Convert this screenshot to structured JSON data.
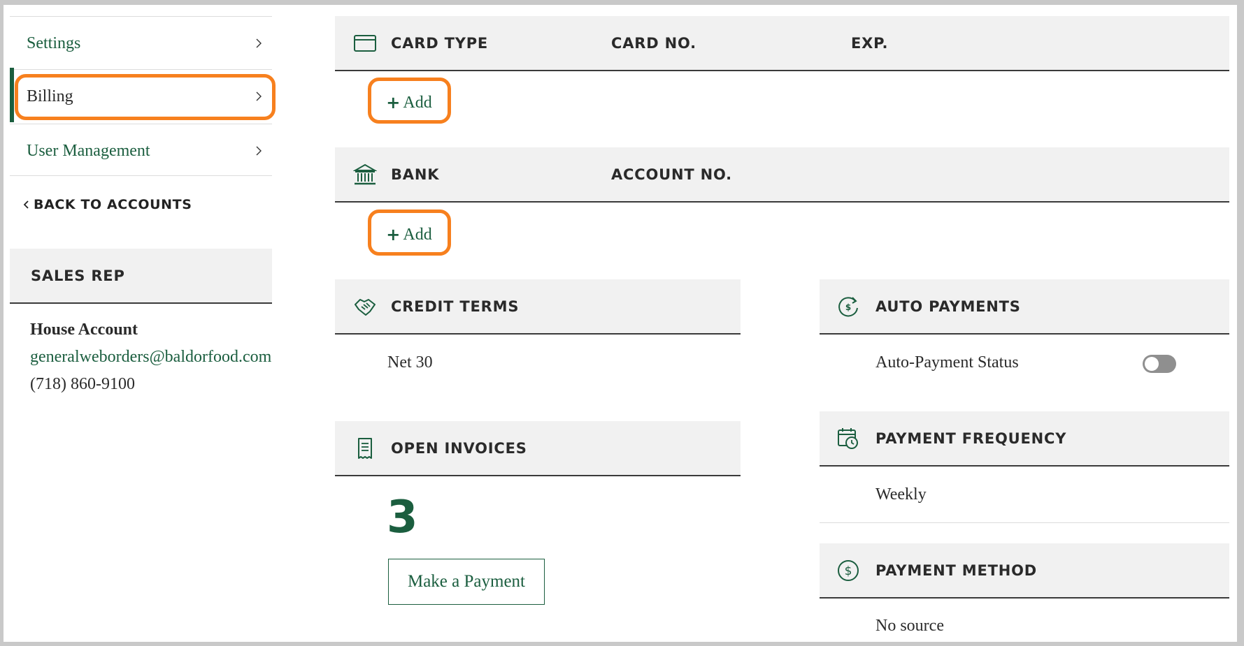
{
  "sidebar": {
    "items": [
      {
        "label": "Settings",
        "icon": "chevron-right-icon"
      },
      {
        "label": "Billing",
        "icon": "chevron-right-icon",
        "active": true
      },
      {
        "label": "User Management",
        "icon": "chevron-right-icon"
      }
    ],
    "back_link": "BACK TO ACCOUNTS",
    "sales_rep": {
      "heading": "SALES REP",
      "name": "House Account",
      "email": "generalweborders@baldorfood.com",
      "phone": "(718) 860-9100"
    }
  },
  "cards": {
    "icon": "credit-card-icon",
    "headers": [
      "CARD TYPE",
      "CARD NO.",
      "EXP."
    ],
    "add_label": "Add"
  },
  "bank": {
    "icon": "bank-icon",
    "headers": [
      "BANK",
      "ACCOUNT NO."
    ],
    "add_label": "Add"
  },
  "credit_terms": {
    "icon": "handshake-icon",
    "heading": "CREDIT TERMS",
    "value": "Net 30"
  },
  "open_invoices": {
    "icon": "invoice-icon",
    "heading": "OPEN INVOICES",
    "count": "3",
    "pay_button": "Make a Payment"
  },
  "auto_payments": {
    "icon": "recurring-dollar-icon",
    "heading": "AUTO PAYMENTS",
    "status_label": "Auto-Payment Status",
    "enabled": false
  },
  "payment_frequency": {
    "icon": "calendar-clock-icon",
    "heading": "PAYMENT FREQUENCY",
    "value": "Weekly"
  },
  "payment_method": {
    "icon": "dollar-circle-icon",
    "heading": "PAYMENT METHOD",
    "value": "No source"
  },
  "colors": {
    "brand_green": "#1b5e3f",
    "highlight_orange": "#f7801e",
    "header_bg": "#f1f1f1"
  }
}
